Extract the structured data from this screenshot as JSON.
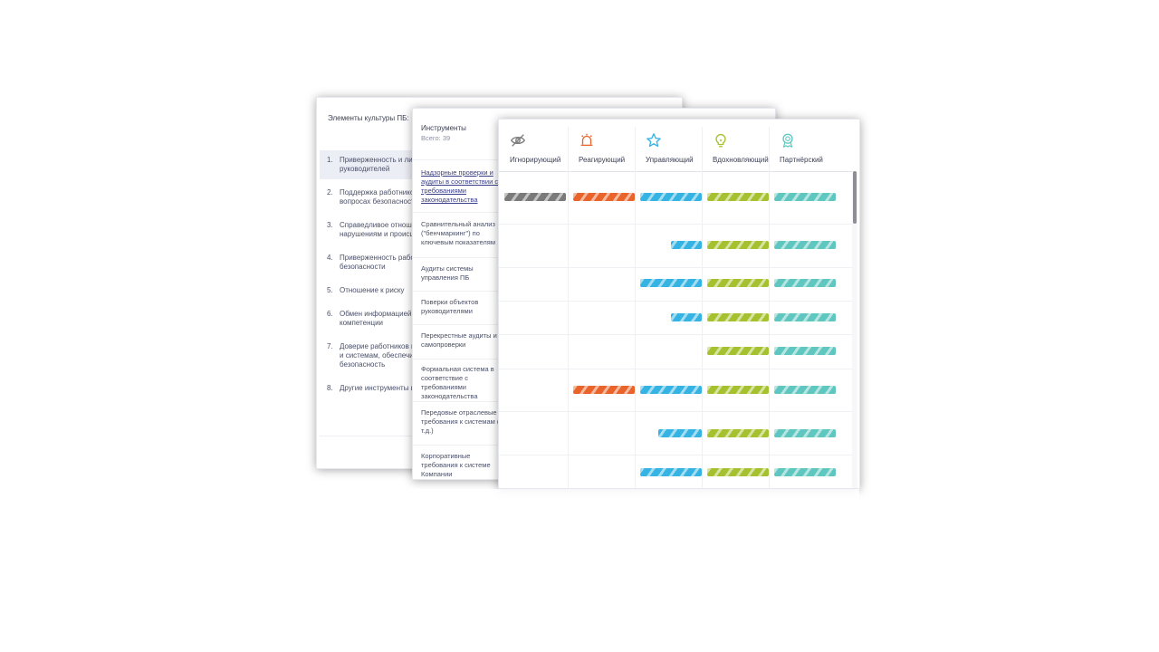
{
  "card_elements": {
    "title": "Элементы культуры ПБ:",
    "items": [
      {
        "num": "1.",
        "text": "Приверженность и лидерство руководителей"
      },
      {
        "num": "2.",
        "text": "Поддержка работников в вопросах безопасности"
      },
      {
        "num": "3.",
        "text": "Справедливое отношение к нарушениям и происшествиям"
      },
      {
        "num": "4.",
        "text": "Приверженность работников безопасности"
      },
      {
        "num": "5.",
        "text": "Отношение к риску"
      },
      {
        "num": "6.",
        "text": "Обмен информацией, обучение и компетенции"
      },
      {
        "num": "7.",
        "text": "Доверие работников к процессам и системам, обеспечивающим безопасность"
      },
      {
        "num": "8.",
        "text": "Другие инструменты и практики"
      }
    ]
  },
  "card_tools": {
    "title": "Инструменты",
    "total": "Всего: 39",
    "items": [
      {
        "text": "Надзорные проверки и аудиты в соответствии с требованиями законодательства"
      },
      {
        "text": "Сравнительный анализ (\"бенчмаркинг\") по ключевым показателям"
      },
      {
        "text": "Аудиты системы управления ПБ"
      },
      {
        "text": "Поверки объектов руководителями"
      },
      {
        "text": "Перекрестные аудиты и самопроверки"
      },
      {
        "text": "Формальная система в соответствие с требованиями законодательства"
      },
      {
        "text": "Передовые отраслевые требования к системам (и т.д.)"
      },
      {
        "text": "Корпоративные требования к системе Компании"
      }
    ]
  },
  "levels": {
    "headers": [
      {
        "label": "Игнорирующий",
        "icon": "eye-crossed-icon",
        "color": "#7a7a7a"
      },
      {
        "label": "Реагирующий",
        "icon": "alarm-bell-icon",
        "color": "#e8642a"
      },
      {
        "label": "Управляющий",
        "icon": "star-icon",
        "color": "#35b3e3"
      },
      {
        "label": "Вдохновляющий",
        "icon": "lightbulb-icon",
        "color": "#a6c12f"
      },
      {
        "label": "Партнёрский",
        "icon": "medal-icon",
        "color": "#5fc7bf"
      }
    ],
    "matrix": [
      [
        1,
        1,
        1,
        1,
        1
      ],
      [
        0,
        0,
        0.5,
        1,
        1
      ],
      [
        0,
        0,
        1,
        1,
        1
      ],
      [
        0,
        0,
        0.5,
        1,
        1
      ],
      [
        0,
        0,
        0,
        1,
        1
      ],
      [
        0,
        1,
        1,
        1,
        1
      ],
      [
        0,
        0,
        0.7,
        1,
        1
      ],
      [
        0,
        0,
        1,
        1,
        1
      ]
    ]
  }
}
